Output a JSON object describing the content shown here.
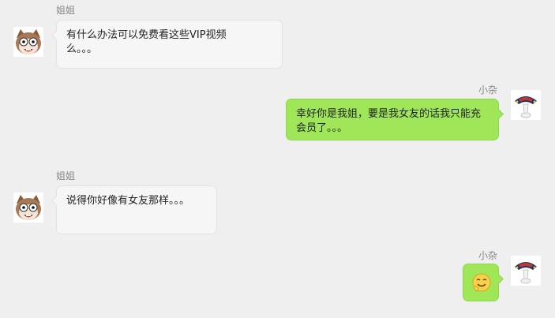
{
  "messages": [
    {
      "side": "left",
      "sender": "姐姐",
      "avatar": "cat-face-icon",
      "text": "有什么办法可以免费看这些VIP视频么。。。"
    },
    {
      "side": "right",
      "sender": "小杂",
      "avatar": "jester-hat-icon",
      "text": "幸好你是我姐，要是我女友的话我只能充会员了。。。"
    },
    {
      "side": "left",
      "sender": "姐姐",
      "avatar": "cat-face-icon",
      "text": "说得你好像有女友那样。。。"
    },
    {
      "side": "right",
      "sender": "小杂",
      "avatar": "jester-hat-icon",
      "emoji": "awkward-smile-emoji-icon"
    }
  ],
  "colors": {
    "background": "#efefef",
    "left_bubble": "#f6f6f6",
    "right_bubble": "#9fe659",
    "name_text": "#888888"
  }
}
